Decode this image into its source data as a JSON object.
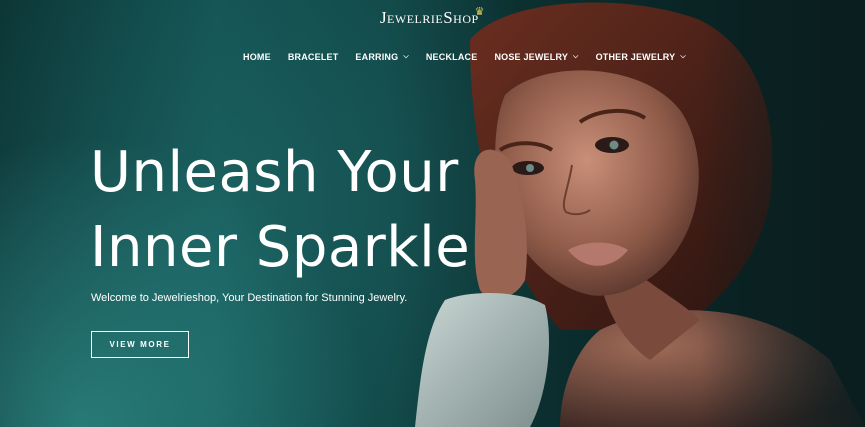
{
  "brand": {
    "logo_text": "JewelrieShop",
    "logo_icon": "crown-icon"
  },
  "nav": {
    "items": [
      {
        "label": "HOME",
        "has_dropdown": false
      },
      {
        "label": "BRACELET",
        "has_dropdown": false
      },
      {
        "label": "EARRING",
        "has_dropdown": true
      },
      {
        "label": "NECKLACE",
        "has_dropdown": false
      },
      {
        "label": "NOSE JEWELRY",
        "has_dropdown": true
      },
      {
        "label": "OTHER JEWELRY",
        "has_dropdown": true
      }
    ],
    "dropdown_icon": "chevron-down-icon"
  },
  "hero": {
    "headline_line1": "Unleash Your",
    "headline_line2": "Inner Sparkle",
    "subtext": "Welcome to Jewelrieshop, Your Destination for Stunning Jewelry.",
    "cta_label": "VIEW MORE",
    "image": "portrait-photo"
  },
  "colors": {
    "accent": "#e8c94a",
    "text": "#ffffff",
    "background_teal": "#135252",
    "background_dark": "#0a1e20"
  }
}
